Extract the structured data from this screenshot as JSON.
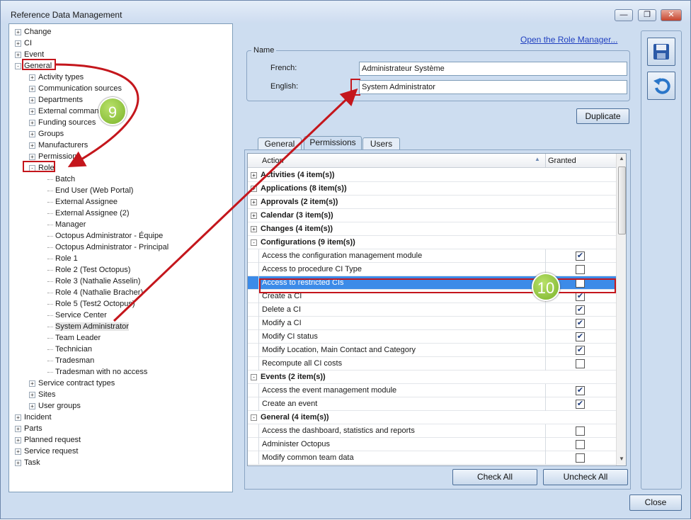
{
  "window": {
    "title": "Reference Data Management",
    "controls": [
      "minimize",
      "restore",
      "close"
    ]
  },
  "tree": {
    "top_items_before": [
      "Change",
      "CI",
      "Event"
    ],
    "general_label": "General",
    "general_children_before_role": [
      "Activity types",
      "Communication sources",
      "Departments",
      "External commands",
      "Funding sources",
      "Groups",
      "Manufacturers",
      "Permissions"
    ],
    "role_label": "Role",
    "role_children": [
      "Batch",
      "End User (Web Portal)",
      "External Assignee",
      "External Assignee (2)",
      "Manager",
      "Octopus Administrator - Équipe",
      "Octopus Administrator - Principal",
      "Role 1",
      "Role 2 (Test Octopus)",
      "Role 3 (Nathalie Asselin)",
      "Role 4 (Nathalie Bracher)",
      "Role 5 (Test2 Octopus)",
      "Service Center",
      "System Administrator",
      "Team Leader",
      "Technician",
      "Tradesman",
      "Tradesman with no access"
    ],
    "general_children_after_role": [
      "Service contract types",
      "Sites",
      "User groups"
    ],
    "top_items_after": [
      "Incident",
      "Parts",
      "Planned request",
      "Service request",
      "Task"
    ]
  },
  "role_manager_link": "Open the Role Manager...",
  "name_group": {
    "legend": "Name",
    "french_label": "French:",
    "french_value": "Administrateur Système",
    "english_label": "English:",
    "english_value": "System Administrator"
  },
  "duplicate_button": "Duplicate",
  "tabs": [
    "General",
    "Permissions",
    "Users"
  ],
  "active_tab": "Permissions",
  "grid": {
    "col_action": "Action",
    "col_granted": "Granted",
    "rows": [
      {
        "type": "cat",
        "label": "Activities (4 item(s))",
        "expanded": false
      },
      {
        "type": "cat",
        "label": "Applications (8 item(s))",
        "expanded": false
      },
      {
        "type": "cat",
        "label": "Approvals (2 item(s))",
        "expanded": false
      },
      {
        "type": "cat",
        "label": "Calendar (3 item(s))",
        "expanded": false
      },
      {
        "type": "cat",
        "label": "Changes (4 item(s))",
        "expanded": false
      },
      {
        "type": "cat",
        "label": "Configurations (9 item(s))",
        "expanded": true
      },
      {
        "type": "item",
        "label": "Access the configuration management module",
        "checked": true
      },
      {
        "type": "item",
        "label": "Access to procedure CI Type",
        "checked": false
      },
      {
        "type": "item",
        "label": "Access to restricted CIs",
        "checked": false,
        "selected": true
      },
      {
        "type": "item",
        "label": "Create a CI",
        "checked": true
      },
      {
        "type": "item",
        "label": "Delete a CI",
        "checked": true
      },
      {
        "type": "item",
        "label": "Modify a CI",
        "checked": true
      },
      {
        "type": "item",
        "label": "Modify CI status",
        "checked": true
      },
      {
        "type": "item",
        "label": "Modify Location, Main Contact and Category",
        "checked": true
      },
      {
        "type": "item",
        "label": "Recompute all CI costs",
        "checked": false
      },
      {
        "type": "cat",
        "label": "Events (2 item(s))",
        "expanded": true
      },
      {
        "type": "item",
        "label": "Access the event management module",
        "checked": true
      },
      {
        "type": "item",
        "label": "Create an event",
        "checked": true
      },
      {
        "type": "cat",
        "label": "General (4 item(s))",
        "expanded": true
      },
      {
        "type": "item",
        "label": "Access the dashboard, statistics and reports",
        "checked": false
      },
      {
        "type": "item",
        "label": "Administer Octopus",
        "checked": false
      },
      {
        "type": "item",
        "label": "Modify common team data",
        "checked": false
      }
    ]
  },
  "check_all_button": "Check All",
  "uncheck_all_button": "Uncheck All",
  "close_button": "Close",
  "callouts": {
    "step_9": "9",
    "step_10": "10"
  },
  "icons": {
    "save": "save-icon",
    "undo": "undo-icon"
  },
  "colors": {
    "selection": "#3c8be8",
    "highlight": "#c4161c",
    "callout": "#8cc63f"
  }
}
